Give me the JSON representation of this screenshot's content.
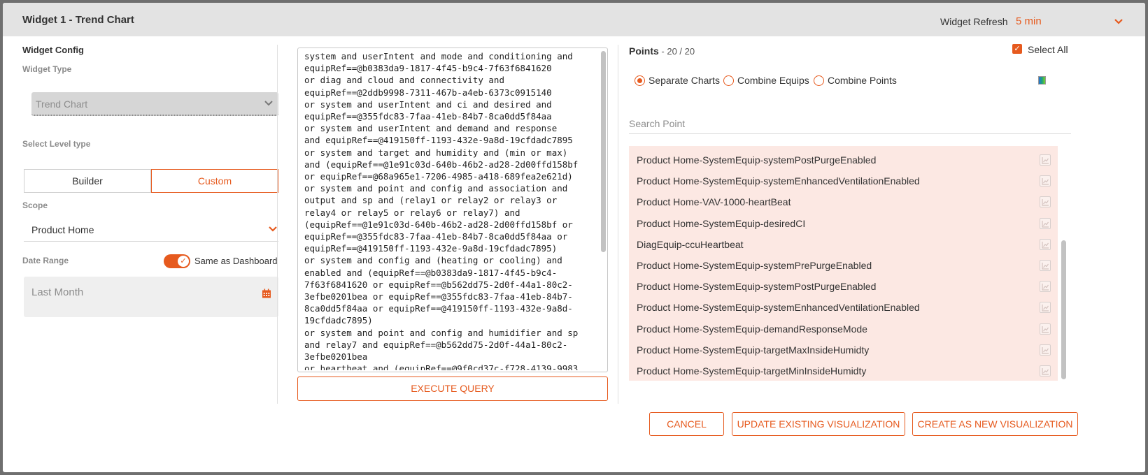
{
  "header": {
    "title": "Widget 1 - Trend Chart",
    "refresh_label": "Widget Refresh",
    "refresh_value": "5 min"
  },
  "config": {
    "section_title": "Widget Config",
    "widget_type_label": "Widget Type",
    "widget_type_value": "Trend Chart",
    "level_type_label": "Select Level type",
    "builder_label": "Builder",
    "custom_label": "Custom",
    "scope_label": "Scope",
    "scope_value": "Product Home",
    "date_range_label": "Date Range",
    "same_as_dashboard_label": "Same as Dashboard",
    "same_as_dashboard_on": true,
    "date_value": "Last Month"
  },
  "query": {
    "lines": [
      "system and userIntent and mode and conditioning and",
      "equipRef==@b0383da9-1817-4f45-b9c4-7f63f6841620",
      "or diag and cloud and connectivity and",
      "equipRef==@2ddb9998-7311-467b-a4eb-6373c0915140",
      "or system and userIntent and ci and desired and",
      "equipRef==@355fdc83-7faa-41eb-84b7-8ca0dd5f84aa",
      "or system and userIntent and demand and response",
      "and equipRef==@419150ff-1193-432e-9a8d-19cfdadc7895",
      "or system and target and humidity and (min or max)",
      "and (equipRef==@1e91c03d-640b-46b2-ad28-2d00ffd158bf",
      "or equipRef==@68a965e1-7206-4985-a418-689fea2e621d)",
      "or system and point and config and association and",
      "output and sp and (relay1 or relay2 or relay3 or",
      "relay4 or relay5 or relay6 or relay7) and",
      "(equipRef==@1e91c03d-640b-46b2-ad28-2d00ffd158bf or",
      "equipRef==@355fdc83-7faa-41eb-84b7-8ca0dd5f84aa or",
      "equipRef==@419150ff-1193-432e-9a8d-19cfdadc7895)",
      "or system and config and (heating or cooling) and",
      "enabled and (equipRef==@b0383da9-1817-4f45-b9c4-",
      "7f63f6841620 or equipRef==@b562dd75-2d0f-44a1-80c2-",
      "3efbe0201bea or equipRef==@355fdc83-7faa-41eb-84b7-",
      "8ca0dd5f84aa or equipRef==@419150ff-1193-432e-9a8d-",
      "19cfdadc7895)",
      "or system and point and config and humidifier and sp",
      "and relay7 and equipRef==@b562dd75-2d0f-44a1-80c2-",
      "3efbe0201bea",
      "or heartbeat and (equipRef==@9f0cd37c-f728-4139-9983"
    ],
    "execute_label": "EXECUTE QUERY"
  },
  "points": {
    "title": "Points",
    "count": " - 20 / 20",
    "select_all_label": "Select All",
    "select_all_checked": true,
    "chart_modes": [
      "Separate Charts",
      "Combine Equips",
      "Combine Points"
    ],
    "selected_mode": "Separate Charts",
    "search_placeholder": "Search Point",
    "visible_items": [
      "Product Home-SystemEquip-systemPostPurgeEnabled",
      "Product Home-SystemEquip-systemEnhancedVentilationEnabled",
      "Product Home-VAV-1000-heartBeat",
      "Product Home-SystemEquip-desiredCI",
      "DiagEquip-ccuHeartbeat",
      "Product Home-SystemEquip-systemPrePurgeEnabled",
      "Product Home-SystemEquip-systemPostPurgeEnabled",
      "Product Home-SystemEquip-systemEnhancedVentilationEnabled",
      "Product Home-SystemEquip-demandResponseMode",
      "Product Home-SystemEquip-targetMaxInsideHumidty",
      "Product Home-SystemEquip-targetMinInsideHumidty"
    ]
  },
  "footer": {
    "cancel_label": "CANCEL",
    "update_label": "UPDATE EXISTING VISUALIZATION",
    "create_label": "CREATE AS NEW VISUALIZATION"
  },
  "colors": {
    "accent": "#e65a1e",
    "list_bg": "#fce8e3",
    "header_bg": "#e3e3e3"
  },
  "icons": [
    "chevron-down-icon",
    "calendar-icon",
    "check-icon",
    "chart-icon",
    "gradient-icon"
  ]
}
